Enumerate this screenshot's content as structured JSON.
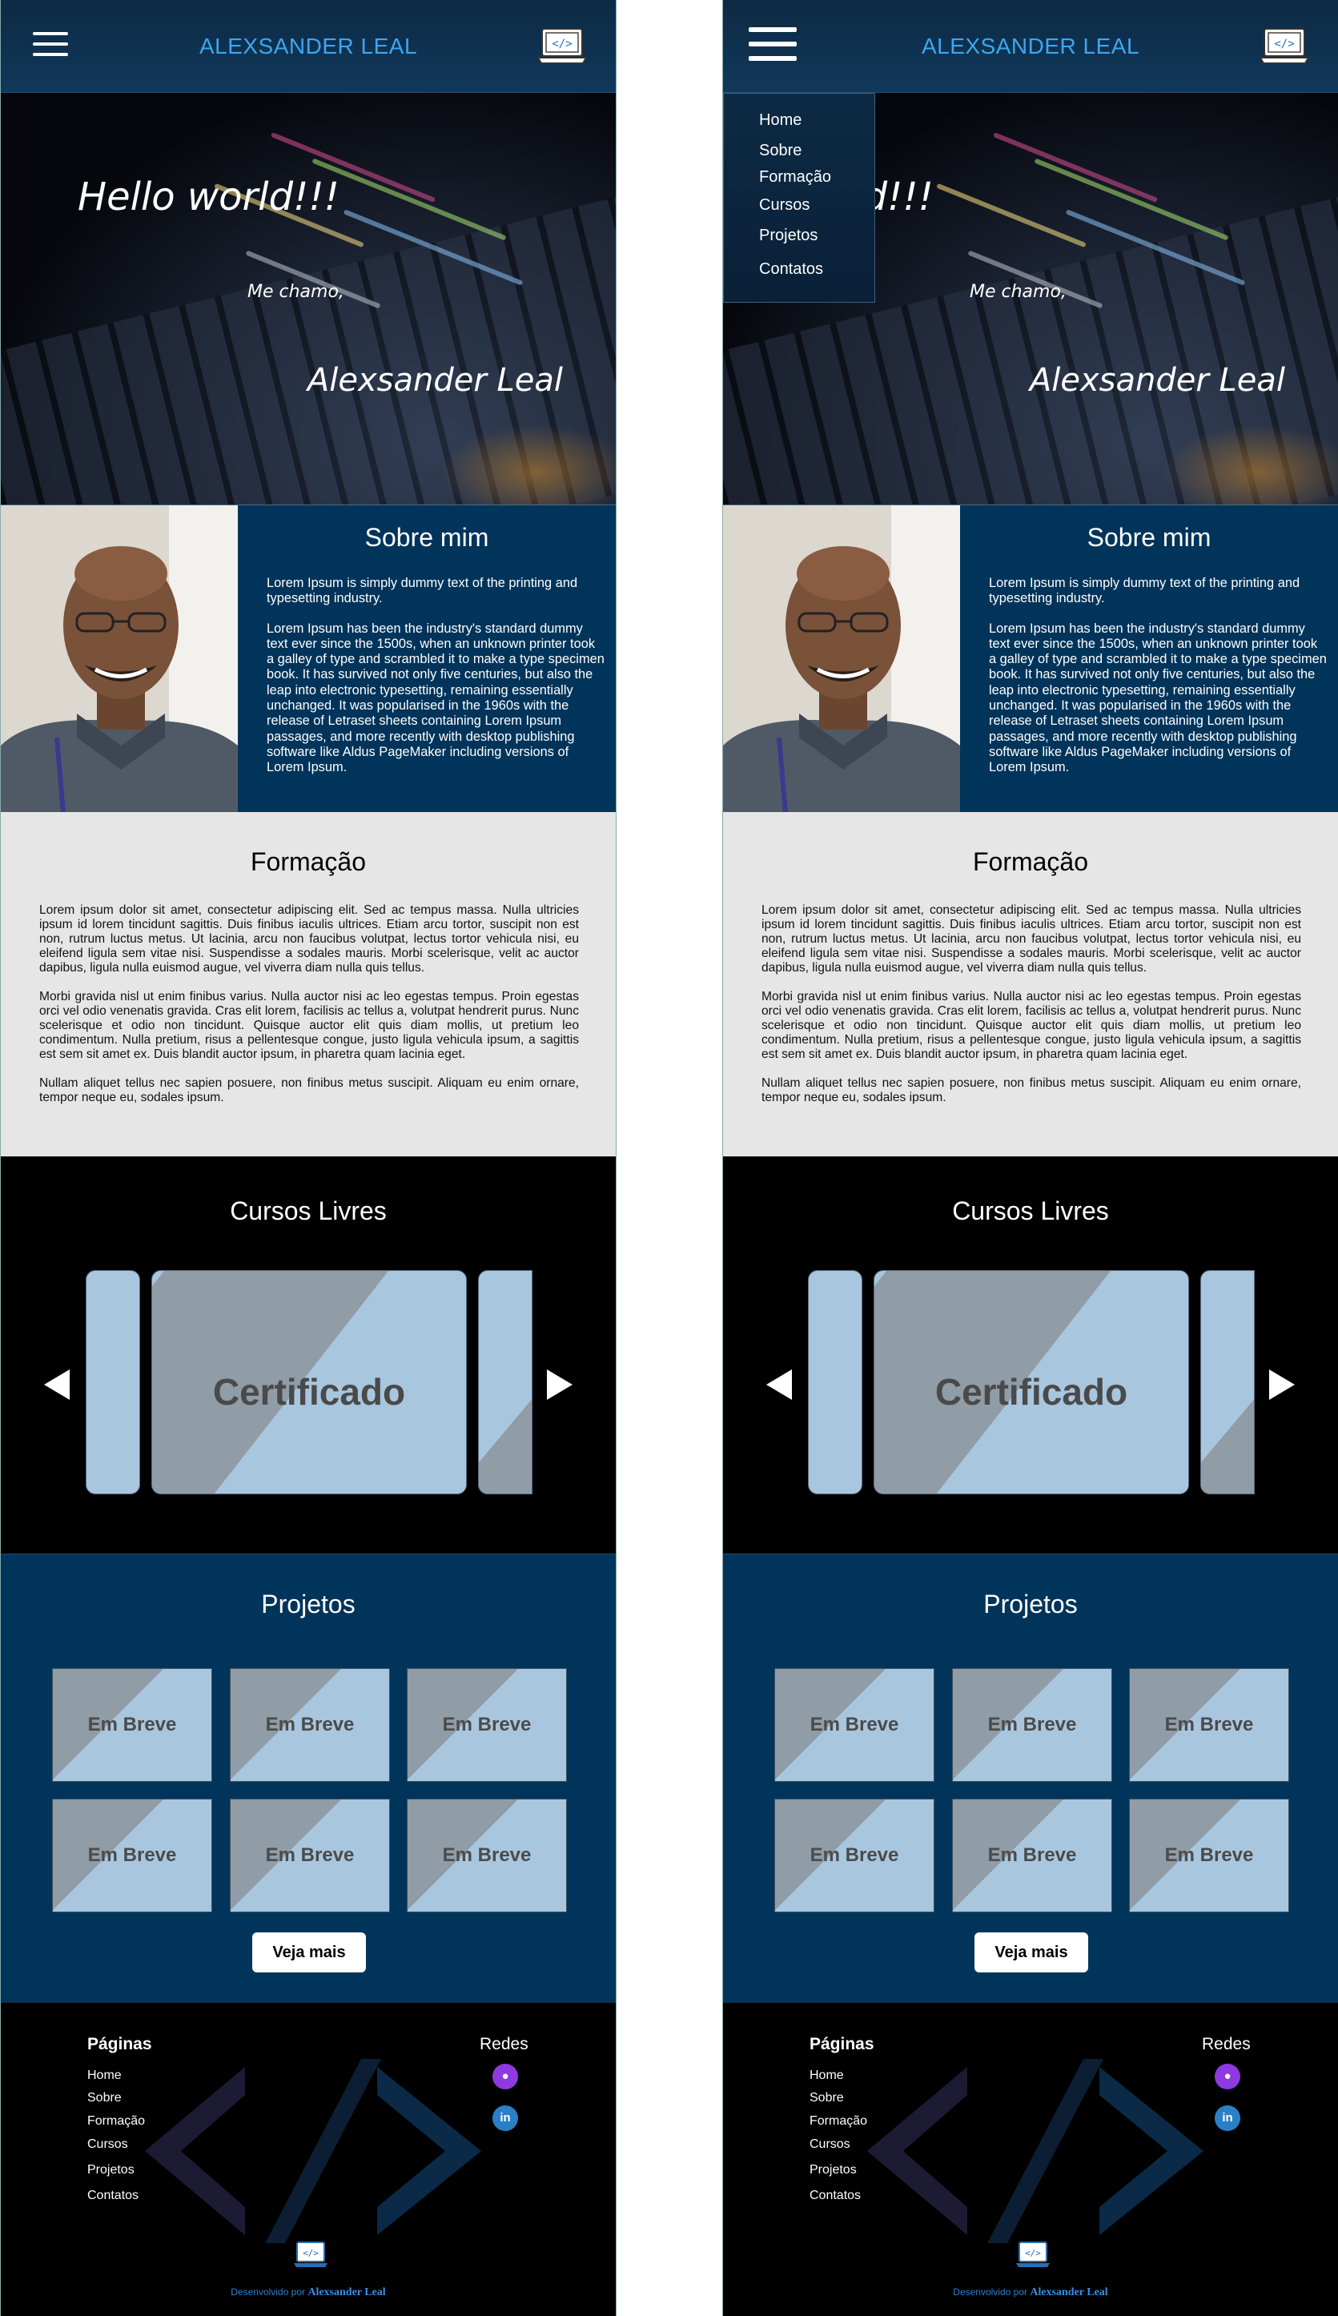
{
  "header": {
    "brand": "ALEXSANDER LEAL"
  },
  "hero": {
    "greeting": "Hello world!!!",
    "intro": "Me chamo,",
    "name": "Alexsander Leal"
  },
  "menu": {
    "items": [
      "Home",
      "Sobre",
      "Formação",
      "Cursos",
      "Projetos",
      "Contatos"
    ]
  },
  "sobre": {
    "title": "Sobre mim",
    "p1": "Lorem Ipsum is simply dummy text of the printing and typesetting industry.",
    "p2": "Lorem Ipsum has been the industry's standard dummy text ever since the 1500s, when an unknown printer took a galley of type and scrambled it to make a type specimen book. It has survived not only five centuries, but also the leap into electronic typesetting, remaining essentially unchanged. It was popularised in the 1960s with the release of Letraset sheets containing Lorem Ipsum passages, and more recently with desktop publishing software like Aldus PageMaker including versions of Lorem Ipsum."
  },
  "formacao": {
    "title": "Formação",
    "p1": "Lorem ipsum dolor sit amet, consectetur adipiscing elit. Sed ac tempus massa. Nulla ultricies ipsum id lorem tincidunt sagittis. Duis finibus iaculis ultrices. Etiam arcu tortor, suscipit non est non, rutrum luctus metus. Ut lacinia, arcu non faucibus volutpat, lectus tortor vehicula nisi, eu eleifend ligula sem vitae nisi. Suspendisse a sodales mauris. Morbi scelerisque, velit ac auctor dapibus, ligula nulla euismod augue, vel viverra diam nulla quis tellus.",
    "p2": "Morbi gravida nisl ut enim finibus varius. Nulla auctor nisi ac leo egestas tempus. Proin egestas orci vel odio venenatis gravida. Cras elit lorem, facilisis ac tellus a, volutpat hendrerit purus. Nunc scelerisque et odio non tincidunt. Quisque auctor elit quis diam mollis, ut pretium leo condimentum. Nulla pretium, risus a pellentesque congue, justo ligula vehicula ipsum, a sagittis est sem sit amet ex. Duis blandit auctor ipsum, in pharetra quam lacinia eget.",
    "p3": "Nullam aliquet tellus nec sapien posuere, non finibus metus suscipit. Aliquam eu enim ornare, tempor neque eu, sodales ipsum."
  },
  "cursos": {
    "title": "Cursos Livres",
    "card_label": "Certificado"
  },
  "projetos": {
    "title": "Projetos",
    "card_label": "Em Breve",
    "more_button": "Veja mais"
  },
  "footer": {
    "pages_title": "Páginas",
    "links": [
      "Home",
      "Sobre",
      "Formação",
      "Cursos",
      "Projetos",
      "Contatos"
    ],
    "redes_title": "Redes",
    "credit_prefix": "Desenvolvido por",
    "credit_name": "Alexsander Leal"
  },
  "colors": {
    "header_bg": "#0d2a44",
    "brand": "#3ea6f0",
    "section_blue": "#00345a",
    "light_gray": "#e6e6e6",
    "card_blue": "#a9c6df",
    "card_stripe": "#909ca6",
    "github": "#8f39e0",
    "linkedin": "#2a80c6"
  },
  "icons": {
    "menu": "hamburger-icon",
    "logo": "laptop-code-icon",
    "prev": "triangle-left-icon",
    "next": "triangle-right-icon",
    "github": "github-icon",
    "linkedin": "linkedin-icon"
  }
}
